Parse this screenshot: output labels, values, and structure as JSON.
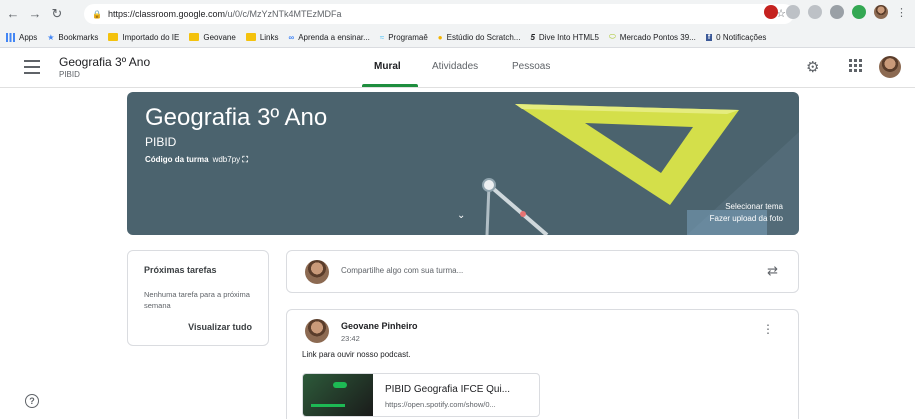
{
  "browser": {
    "url_host": "https://classroom.google.com",
    "url_path": "/u/0/c/MzYzNTk4MTEzMDFa",
    "bookmarks": [
      {
        "label": "Apps"
      },
      {
        "label": "Bookmarks"
      },
      {
        "label": "Importado do IE"
      },
      {
        "label": "Geovane"
      },
      {
        "label": "Links"
      },
      {
        "label": "Aprenda a ensinar..."
      },
      {
        "label": "Programaê"
      },
      {
        "label": "Estúdio do Scratch..."
      },
      {
        "label": "Dive Into HTML5"
      },
      {
        "label": "Mercado Pontos 39..."
      },
      {
        "label": "0 Notificações"
      }
    ]
  },
  "appbar": {
    "class_name": "Geografia 3º Ano",
    "class_section": "PIBID",
    "tabs": [
      {
        "label": "Mural"
      },
      {
        "label": "Atividades"
      },
      {
        "label": "Pessoas"
      }
    ]
  },
  "banner": {
    "title": "Geografia 3º Ano",
    "section": "PIBID",
    "code_label": "Código da turma",
    "code_value": "wdb7py",
    "select_theme": "Selecionar tema",
    "upload_photo": "Fazer upload da foto"
  },
  "upcoming": {
    "title": "Próximas tarefas",
    "body": "Nenhuma tarefa para a próxima semana",
    "view_all": "Visualizar tudo"
  },
  "share": {
    "placeholder": "Compartilhe algo com sua turma..."
  },
  "post": {
    "author": "Geovane Pinheiro",
    "time": "23:42",
    "text": "Link para ouvir nosso podcast.",
    "attachment_title": "PIBID Geografia IFCE Qui...",
    "attachment_url": "https://open.spotify.com/show/0..."
  },
  "colors": {
    "banner": "#4b636e",
    "active_tab": "#1e8e3e",
    "ruler": "#d4df4a"
  }
}
